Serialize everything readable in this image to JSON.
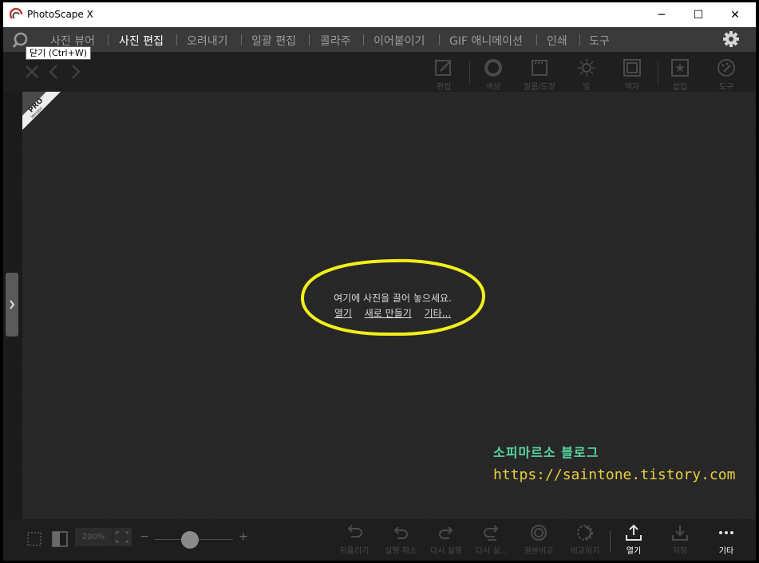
{
  "window": {
    "title": "PhotoScape X",
    "minimize_glyph": "─",
    "maximize_glyph": "☐",
    "close_glyph": "✕"
  },
  "nav": {
    "tabs": [
      {
        "label": "사진 뷰어",
        "active": false
      },
      {
        "label": "사진 편집",
        "active": true
      },
      {
        "label": "오려내기",
        "active": false
      },
      {
        "label": "일괄 편집",
        "active": false
      },
      {
        "label": "콜라주",
        "active": false
      },
      {
        "label": "이어붙이기",
        "active": false
      },
      {
        "label": "GIF 애니메이션",
        "active": false
      },
      {
        "label": "인쇄",
        "active": false
      },
      {
        "label": "도구",
        "active": false
      }
    ],
    "tooltip": "닫기 (Ctrl+W)"
  },
  "toolbar": {
    "tools": [
      {
        "label": "편집",
        "icon": "pencil-icon"
      },
      {
        "label": "색상",
        "icon": "circle-icon"
      },
      {
        "label": "필름/도장",
        "icon": "film-icon"
      },
      {
        "label": "빛",
        "icon": "sun-icon"
      },
      {
        "label": "액자",
        "icon": "frame-icon"
      },
      {
        "label": "삽입",
        "icon": "star-icon"
      },
      {
        "label": "도구",
        "icon": "palette-icon"
      }
    ]
  },
  "canvas": {
    "badge_pro": "PRO",
    "badge_version": "Version",
    "drop_message": "여기에 사진을 끌어 놓으세요.",
    "links": {
      "open": "열기",
      "new": "새로 만들기",
      "more": "기타..."
    }
  },
  "watermark": {
    "title": "소피마르소 블로그",
    "url": "https://saintone.tistory.com"
  },
  "bottom": {
    "zoom": "200%",
    "tools": [
      {
        "label": "뒤틀리기",
        "icon": "undo-all-icon",
        "active": false
      },
      {
        "label": "실행 취소",
        "icon": "undo-icon",
        "active": false
      },
      {
        "label": "다시 실행",
        "icon": "redo-icon",
        "active": false
      },
      {
        "label": "다시 실...",
        "icon": "redo-all-icon",
        "active": false
      },
      {
        "label": "원본비교",
        "icon": "compare-icon",
        "active": false
      },
      {
        "label": "비교하기",
        "icon": "compare-split-icon",
        "active": false
      },
      {
        "label": "열기",
        "icon": "upload-icon",
        "active": true
      },
      {
        "label": "저장",
        "icon": "download-icon",
        "active": false
      },
      {
        "label": "기타",
        "icon": "more-icon",
        "active": true
      }
    ]
  },
  "colors": {
    "watermark_title": "#58d7a0",
    "watermark_url": "#e7cf3f",
    "highlight_ellipse": "#f2ef1a"
  }
}
